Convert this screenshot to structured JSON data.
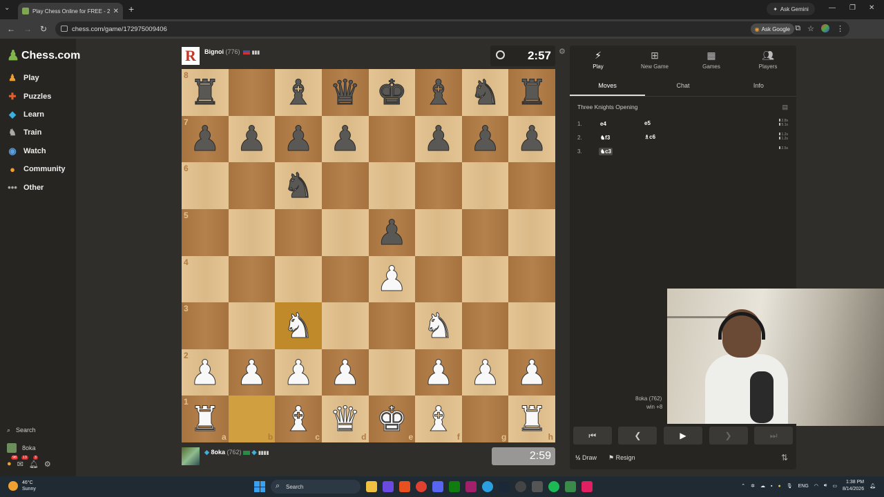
{
  "browser": {
    "tab_title": "Play Chess Online for FREE - 2",
    "url": "chess.com/game/172975009406",
    "gemini": "Ask Gemini",
    "ask_google": "Ask Google"
  },
  "sidebar": {
    "logo": "Chess.com",
    "items": [
      {
        "label": "Play",
        "icon": "pawn-icon"
      },
      {
        "label": "Puzzles",
        "icon": "puzzle-icon"
      },
      {
        "label": "Learn",
        "icon": "learn-icon"
      },
      {
        "label": "Train",
        "icon": "train-icon"
      },
      {
        "label": "Watch",
        "icon": "watch-icon"
      },
      {
        "label": "Community",
        "icon": "community-icon"
      },
      {
        "label": "Other",
        "icon": "more-icon"
      }
    ],
    "search": "Search",
    "user": "8oka",
    "badges": {
      "notif1": "98",
      "notif2": "13",
      "notif3": "3"
    }
  },
  "top_player": {
    "name": "Bignoi",
    "rating": "(776)",
    "clock": "2:57",
    "avatar_letter": "R"
  },
  "bottom_player": {
    "name": "8oka",
    "rating": "(762)",
    "clock": "2:59"
  },
  "board": {
    "ranks": [
      "8",
      "7",
      "6",
      "5",
      "4",
      "3",
      "2",
      "1"
    ],
    "files": [
      "a",
      "b",
      "c",
      "d",
      "e",
      "f",
      "g",
      "h"
    ],
    "position": [
      [
        "bR",
        "",
        "bB",
        "bQ",
        "bK",
        "bB",
        "bN",
        "bR"
      ],
      [
        "bP",
        "bP",
        "bP",
        "bP",
        "",
        "bP",
        "bP",
        "bP"
      ],
      [
        "",
        "",
        "bN",
        "",
        "",
        "",
        "",
        ""
      ],
      [
        "",
        "",
        "",
        "",
        "bP",
        "",
        "",
        ""
      ],
      [
        "",
        "",
        "",
        "",
        "wP",
        "",
        "",
        ""
      ],
      [
        "",
        "",
        "wN",
        "",
        "",
        "wN",
        "",
        ""
      ],
      [
        "wP",
        "wP",
        "wP",
        "wP",
        "",
        "wP",
        "wP",
        "wP"
      ],
      [
        "wR",
        "",
        "wB",
        "wQ",
        "wK",
        "wB",
        "",
        "wR"
      ]
    ],
    "highlight": [
      "b1",
      "c3"
    ]
  },
  "panel": {
    "tabs": [
      {
        "label": "Play",
        "icon": "lightning-icon"
      },
      {
        "label": "New Game",
        "icon": "plus-icon"
      },
      {
        "label": "Games",
        "icon": "board-icon"
      },
      {
        "label": "Players",
        "icon": "players-icon"
      }
    ],
    "subtabs": [
      "Moves",
      "Chat",
      "Info"
    ],
    "opening": "Three Knights Opening",
    "moves": [
      {
        "num": "1.",
        "white": "e4",
        "black": "e5",
        "times": [
          "2.8s",
          "5.1s"
        ]
      },
      {
        "num": "2.",
        "white": "♞f3",
        "black": "♗c6",
        "times": [
          "1.2s",
          "1.2s"
        ]
      },
      {
        "num": "3.",
        "white": "♞c3",
        "black": "",
        "times": [
          "2.5s"
        ]
      }
    ],
    "webcam_label": "8oka (762)",
    "webcam_sub": "win +8",
    "draw": "Draw",
    "resign": "Resign"
  },
  "taskbar": {
    "temp": "46°C",
    "weather": "Sunny",
    "search": "Search",
    "lang": "ENG",
    "time": "1:38 PM",
    "date": "8/14/2026"
  }
}
